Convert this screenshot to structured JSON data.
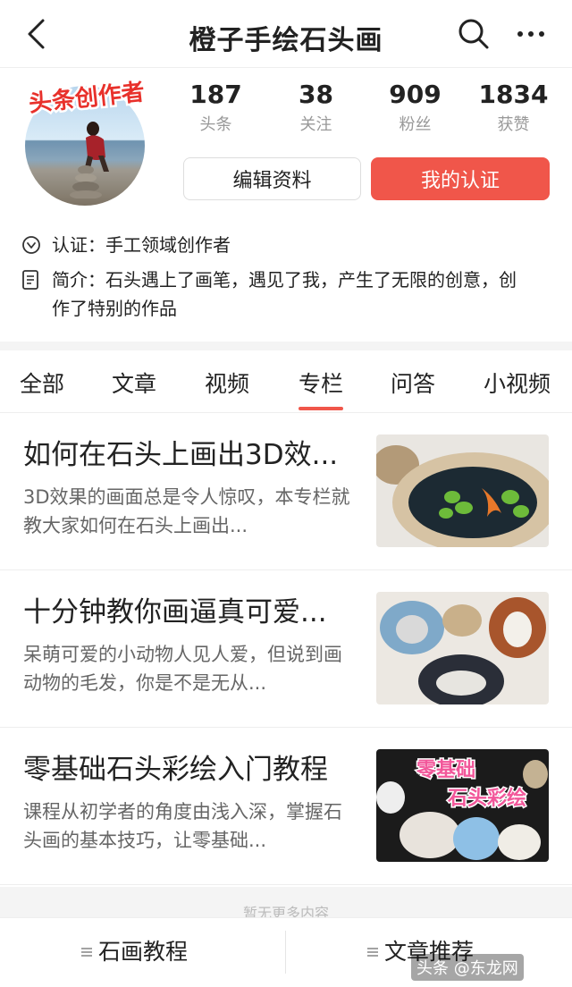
{
  "navbar": {
    "title": "橙子手绘石头画",
    "back_icon": "chevron-left-icon",
    "search_icon": "search-icon",
    "more_icon": "more-horizontal-icon"
  },
  "profile": {
    "avatar_badge_text": "头条创作者",
    "stats": [
      {
        "value": "187",
        "label": "头条"
      },
      {
        "value": "38",
        "label": "关注"
      },
      {
        "value": "909",
        "label": "粉丝"
      },
      {
        "value": "1834",
        "label": "获赞"
      }
    ],
    "edit_button": "编辑资料",
    "verify_button": "我的认证",
    "verify_info": "认证：手工领域创作者",
    "intro": "简介：石头遇上了画笔，遇见了我，产生了无限的创意，创作了特别的作品"
  },
  "tabs": [
    "全部",
    "文章",
    "视频",
    "专栏",
    "问答",
    "小视频"
  ],
  "active_tab": "专栏",
  "articles": [
    {
      "title": "如何在石头上画出3D效...",
      "desc": "3D效果的画面总是令人惊叹，本专栏就教大家如何在石头上画出..."
    },
    {
      "title": "十分钟教你画逼真可爱...",
      "desc": "呆萌可爱的小动物人见人爱，但说到画动物的毛发，你是不是无从..."
    },
    {
      "title": "零基础石头彩绘入门教程",
      "desc": "课程从初学者的角度由浅入深，掌握石头画的基本技巧，让零基础...",
      "thumb_text": "零基础石头彩绘"
    }
  ],
  "more_text": "暂无更多内容",
  "bottom_bar": {
    "left": "石画教程",
    "right": "文章推荐"
  },
  "watermark": "头条 @东龙网",
  "colors": {
    "accent": "#f0564a",
    "text": "#222222",
    "muted": "#999999"
  }
}
